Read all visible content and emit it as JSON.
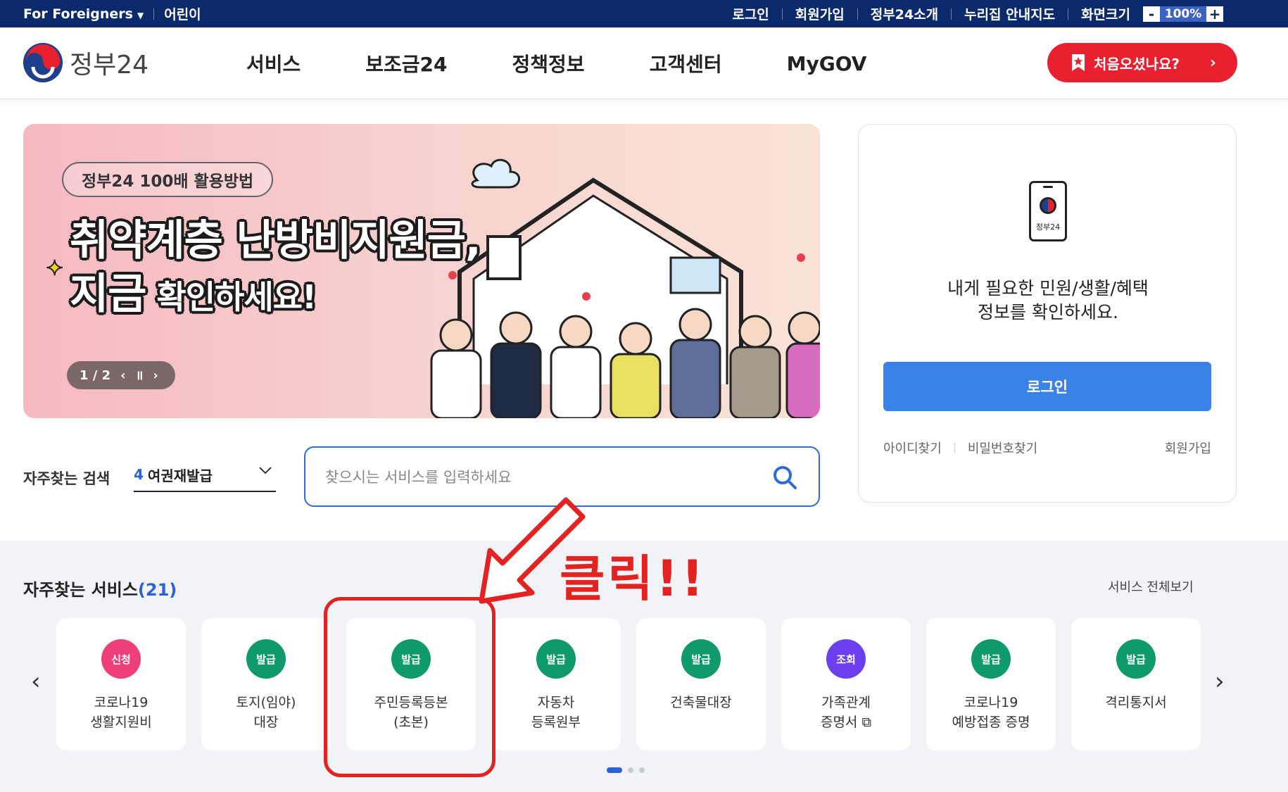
{
  "topbar": {
    "foreigners": "For Foreigners",
    "kids": "어린이",
    "login": "로그인",
    "join": "회원가입",
    "about": "정부24소개",
    "guide": "누리집 안내지도",
    "screen_size": "화면크기",
    "zoom_minus": "-",
    "zoom_value": "100%",
    "zoom_plus": "+"
  },
  "header": {
    "logo_text": "정부24",
    "nav": [
      "서비스",
      "보조금24",
      "정책정보",
      "고객센터",
      "MyGOV"
    ],
    "first_visit": "처음오셨나요?"
  },
  "banner": {
    "tag": "정부24 100배 활용방법",
    "title_line1": "취약계층 난방비지원금,",
    "title_line2_big": "지금",
    "title_line2_small": " 확인하세요!",
    "pager": "1 / 2"
  },
  "login_box": {
    "phone_label": "정부24",
    "desc_line1": "내게 필요한 민원/생활/혜택",
    "desc_line2": "정보를 확인하세요.",
    "login_button": "로그인",
    "find_id": "아이디찾기",
    "find_pw": "비밀번호찾기",
    "join": "회원가입"
  },
  "search": {
    "freq_label": "자주찾는 검색",
    "freq_rank": "4",
    "freq_value": "여권재발급",
    "placeholder": "찾으시는 서비스를 입력하세요"
  },
  "services": {
    "title": "자주찾는 서비스",
    "count": "(21)",
    "view_all": "서비스 전체보기",
    "items": [
      {
        "badge": "신청",
        "label": "코로나19\n생활지원비",
        "color": "#ee3e7c"
      },
      {
        "badge": "발급",
        "label": "토지(임야)\n대장",
        "color": "#0f9a6a"
      },
      {
        "badge": "발급",
        "label": "주민등록등본\n(초본)",
        "color": "#0f9a6a"
      },
      {
        "badge": "발급",
        "label": "자동차\n등록원부",
        "color": "#0f9a6a"
      },
      {
        "badge": "발급",
        "label": "건축물대장",
        "color": "#0f9a6a"
      },
      {
        "badge": "조회",
        "label": "가족관계\n증명서 ⧉",
        "color": "#6b3ff0"
      },
      {
        "badge": "발급",
        "label": "코로나19\n예방접종 증명",
        "color": "#0f9a6a"
      },
      {
        "badge": "발급",
        "label": "격리통지서",
        "color": "#0f9a6a"
      }
    ]
  },
  "annotation": {
    "text": "클릭!!"
  }
}
